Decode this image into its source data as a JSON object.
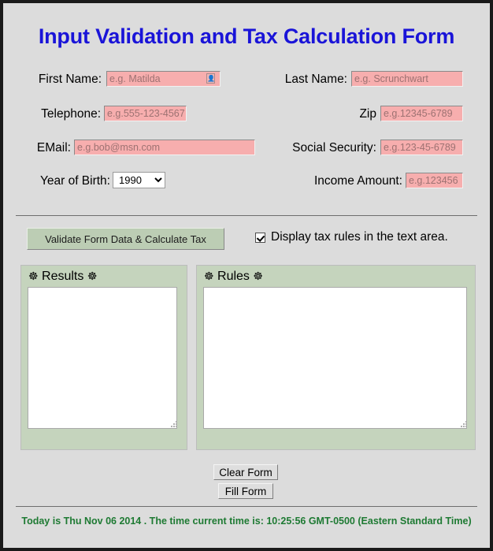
{
  "page": {
    "title": "Input Validation and Tax Calculation Form",
    "title_color": "#1a14d8",
    "background_color": "#dcdcdc",
    "border_color": "#1a1a1a"
  },
  "form": {
    "fields": [
      {
        "id": "first-name",
        "label": "First Name:",
        "placeholder": "e.g. Matilda",
        "value": "",
        "has_autofill_icon": true,
        "icon": "contact-card-icon"
      },
      {
        "id": "last-name",
        "label": "Last Name:",
        "placeholder": "e.g. Scrunchwart",
        "value": "",
        "has_autofill_icon": false
      },
      {
        "id": "telephone",
        "label": "Telephone:",
        "placeholder": "e.g.555-123-4567",
        "value": "",
        "has_autofill_icon": false
      },
      {
        "id": "zip",
        "label": "Zip",
        "placeholder": "e.g.12345-6789",
        "value": "",
        "has_autofill_icon": false
      },
      {
        "id": "email",
        "label": "EMail:",
        "placeholder": "e.g.bob@msn.com",
        "value": "",
        "has_autofill_icon": false
      },
      {
        "id": "social-security",
        "label": "Social Security:",
        "placeholder": "e.g.123-45-6789",
        "value": "",
        "has_autofill_icon": false
      },
      {
        "id": "income-amount",
        "label": "Income Amount:",
        "placeholder": "e.g.123456",
        "value": "",
        "has_autofill_icon": false
      }
    ],
    "year_of_birth": {
      "label": "Year of Birth:",
      "selected": "1990",
      "options": [
        "1990"
      ]
    },
    "input_background_color": "#f7aeae",
    "placeholder_color": "#9d7272"
  },
  "actions": {
    "validate_label": "Validate Form Data & Calculate Tax",
    "validate_color": "#bccdb4",
    "checkbox": {
      "label": "Display tax rules in the text area.",
      "checked": true
    },
    "clear_label": "Clear Form",
    "fill_label": "Fill Form"
  },
  "panels": [
    {
      "id": "results",
      "title": "Results",
      "icon_left": "dharma-wheel-icon",
      "icon_right": "dharma-wheel-icon",
      "glyph": "☸",
      "content": "",
      "background_color": "#c5d4bd"
    },
    {
      "id": "rules",
      "title": "Rules",
      "icon_left": "dharma-wheel-icon",
      "icon_right": "dharma-wheel-icon",
      "glyph": "☸",
      "content": "",
      "background_color": "#c5d4bd"
    }
  ],
  "footer": {
    "text": "Today is Thu Nov 06 2014 . The time current time is: 10:25:56 GMT-0500 (Eastern Standard Time)",
    "color": "#1e7a33"
  }
}
